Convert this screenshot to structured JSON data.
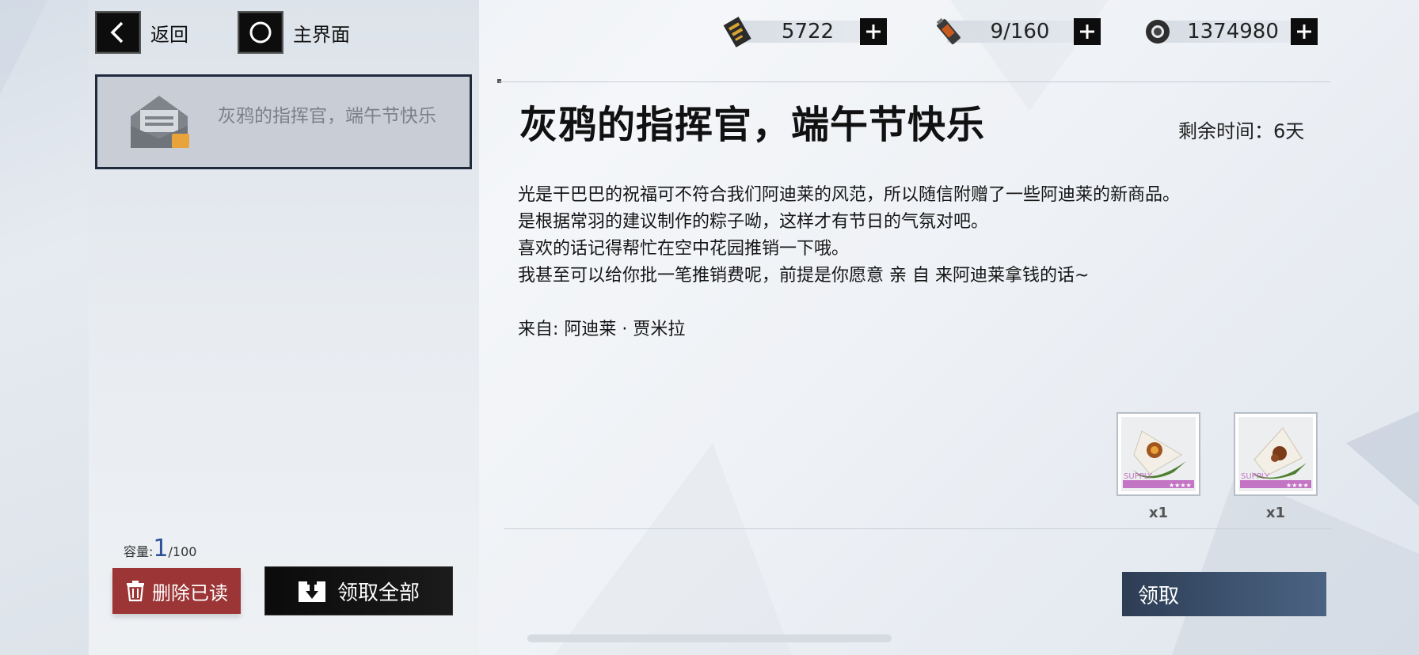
{
  "nav": {
    "back_label": "返回",
    "home_label": "主界面"
  },
  "resources": [
    {
      "icon": "pass-card-icon",
      "value": "5722"
    },
    {
      "icon": "battery-icon",
      "value": "9/160"
    },
    {
      "icon": "gear-token-icon",
      "value": "1374980"
    }
  ],
  "mail_list": {
    "items": [
      {
        "title": "灰鸦的指挥官，端午节快乐",
        "icon": "mail-package-icon"
      }
    ],
    "capacity_label": "容量:",
    "capacity_used": "1",
    "capacity_total": "/100",
    "delete_read_label": "删除已读",
    "claim_all_label": "领取全部"
  },
  "mail": {
    "title": "灰鸦的指挥官，端午节快乐",
    "remaining": "剩余时间：6天",
    "body": [
      "光是干巴巴的祝福可不符合我们阿迪莱的风范，所以随信附赠了一些阿迪莱的新商品。",
      "是根据常羽的建议制作的粽子呦，这样才有节日的气氛对吧。",
      "喜欢的话记得帮忙在空中花园推销一下哦。",
      "我甚至可以给你批一笔推销费呢，前提是你愿意 亲 自 来阿迪莱拿钱的话~"
    ],
    "from": "来自: 阿迪莱 · 贾米拉",
    "rewards": [
      {
        "tag": "SUPPLY",
        "stars": "★★★★",
        "qty": "x1"
      },
      {
        "tag": "SUPPLY",
        "stars": "★★★★",
        "qty": "x1"
      }
    ],
    "claim_label": "领取"
  },
  "colors": {
    "delete_button": "#9c3535",
    "claim_button": "#3f5572",
    "selected_border": "#1e2a3c",
    "supply_tag": "#c474c4"
  }
}
